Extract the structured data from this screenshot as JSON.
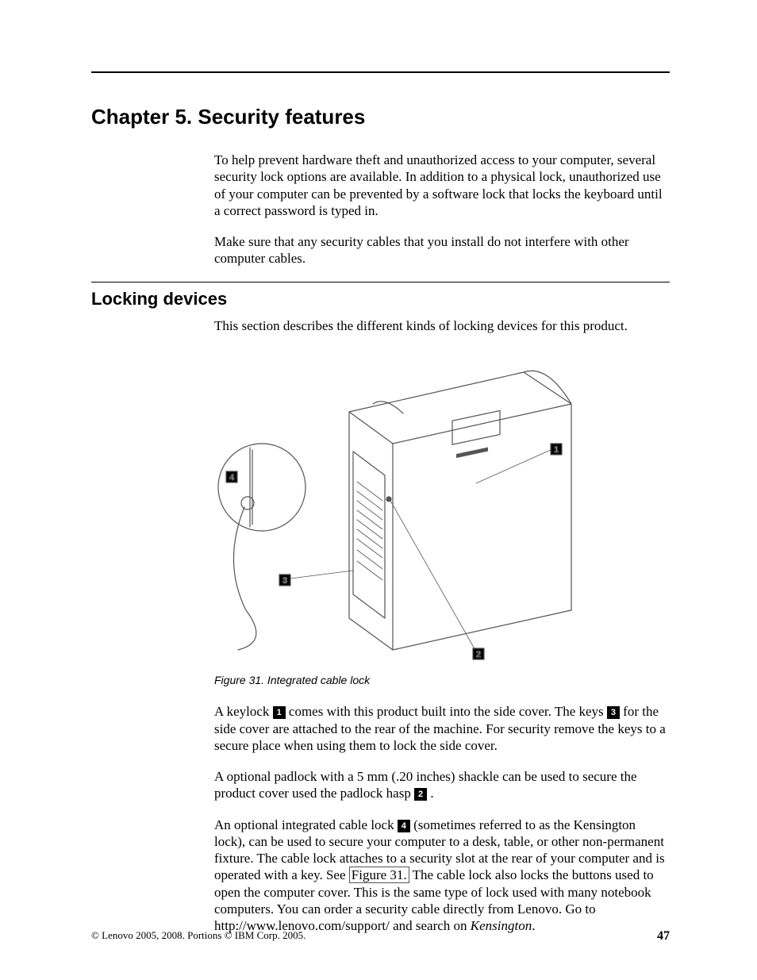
{
  "chapter": {
    "title": "Chapter 5. Security features"
  },
  "intro": {
    "p1": "To help prevent hardware theft and unauthorized access to your computer, several security lock options are available. In addition to a physical lock, unauthorized use of your computer can be prevented by a software lock that locks the keyboard until a correct password is typed in.",
    "p2": "Make sure that any security cables that you install do not interfere with other computer cables."
  },
  "section": {
    "heading": "Locking devices",
    "intro": "This section describes the different kinds of locking devices for this product."
  },
  "figure": {
    "caption": "Figure 31. Integrated cable lock",
    "callouts": {
      "c1": "1",
      "c2": "2",
      "c3": "3",
      "c4": "4"
    }
  },
  "body": {
    "p3a": "A keylock ",
    "p3b": " comes with this product built into the side cover. The keys ",
    "p3c": " for the side cover are attached to the rear of the machine. For security remove the keys to a secure place when using them to lock the side cover.",
    "p4a": "A optional padlock with a 5 mm (.20 inches) shackle can be used to secure the product cover used the padlock hasp ",
    "p4b": " .",
    "p5a": "An optional integrated cable lock ",
    "p5b": " (sometimes referred to as the Kensington lock), can be used to secure your computer to a desk, table, or other non-permanent fixture. The cable lock attaches to a security slot at the rear of your computer and is operated with a key. See ",
    "p5c": "Figure 31.",
    "p5d": " The cable lock also locks the buttons used to open the computer cover. This is the same type of lock used with many notebook computers. You can order a security cable directly from Lenovo. Go to",
    "p5e": "http://www.lenovo.com/support/ and search on ",
    "kensington": "Kensington",
    "p5f": "."
  },
  "footer": {
    "copyright": "© Lenovo 2005, 2008. Portions © IBM Corp. 2005.",
    "page": "47"
  }
}
